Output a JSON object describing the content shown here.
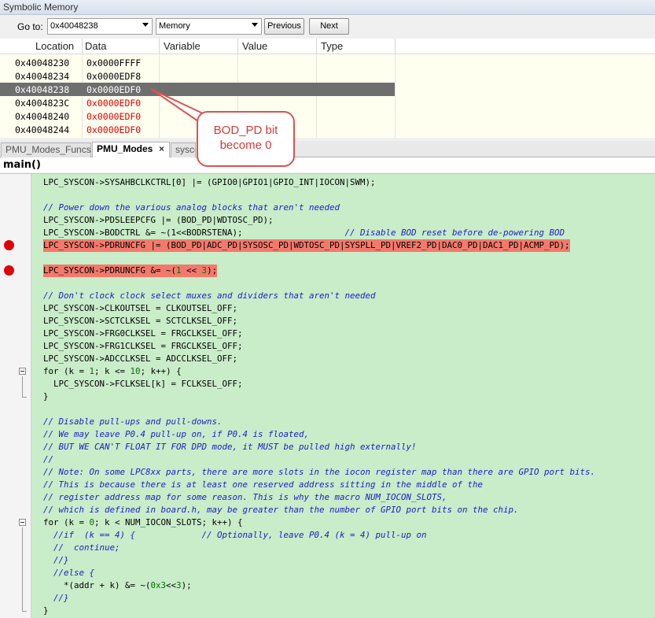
{
  "panel_title": "Symbolic Memory",
  "toolbar": {
    "goto_label": "Go to:",
    "goto_value": "0x40048238",
    "type_value": "Memory",
    "previous_label": "Previous",
    "next_label": "Next"
  },
  "grid": {
    "headers": [
      "Location",
      "Data",
      "Variable",
      "Value",
      "Type"
    ],
    "rows": [
      {
        "addr": "0x40048230",
        "data": "0x0000FFFF"
      },
      {
        "addr": "0x40048234",
        "data": "0x0000EDF8"
      },
      {
        "addr": "0x40048238",
        "data": "0x0000EDF0"
      },
      {
        "addr": "0x4004823C",
        "data": "0x0000EDF0"
      },
      {
        "addr": "0x40048240",
        "data": "0x0000EDF0"
      },
      {
        "addr": "0x40048244",
        "data": "0x0000EDF0"
      }
    ]
  },
  "callout": {
    "line1": "BOD_PD bit",
    "line2": "become 0"
  },
  "tabs": [
    "PMU_Modes_Funcs",
    "PMU_Modes",
    "sysco"
  ],
  "tab_close": "×",
  "function_name": "main()",
  "code": {
    "l1": "LPC_SYSCON->SYSAHBCLKCTRL[0] |= (GPIO0|GPIO1|GPIO_INT|IOCON|SWM);",
    "l2": "// Power down the various analog blocks that aren't needed",
    "l3": "LPC_SYSCON->PDSLEEPCFG |= (BOD_PD|WDTOSC_PD);",
    "l4a": "LPC_SYSCON->BODCTRL &= ~(1<<BODRSTENA);                    ",
    "l4b": "// Disable BOD reset before de-powering BOD",
    "l5": "LPC_SYSCON->PDRUNCFG |= (BOD_PD|ADC_PD|SYSOSC_PD|WDTOSC_PD|SYSPLL_PD|VREF2_PD|DAC0_PD|DAC1_PD|ACMP_PD);",
    "l6a": "LPC_SYSCON->PDRUNCFG &= ~(",
    "l6b": "1",
    "l6c": " << ",
    "l6d": "3",
    "l6e": ");",
    "l7": "// Don't clock clock select muxes and dividers that aren't needed",
    "l8": "LPC_SYSCON->CLKOUTSEL = CLKOUTSEL_OFF;",
    "l9": "LPC_SYSCON->SCTCLKSEL = SCTCLKSEL_OFF;",
    "l10": "LPC_SYSCON->FRG0CLKSEL = FRGCLKSEL_OFF;",
    "l11": "LPC_SYSCON->FRG1CLKSEL = FRGCLKSEL_OFF;",
    "l12": "LPC_SYSCON->ADCCLKSEL = ADCCLKSEL_OFF;",
    "l13a": "for (k = ",
    "l13b": "1",
    "l13c": "; k <= ",
    "l13d": "10",
    "l13e": "; k++) {",
    "l14": "  LPC_SYSCON->FCLKSEL[k] = FCLKSEL_OFF;",
    "l15": "}",
    "l16": "// Disable pull-ups and pull-downs.",
    "l17": "// We may leave P0.4 pull-up on, if P0.4 is floated,",
    "l18": "// BUT WE CAN'T FLOAT IT FOR DPD mode, it MUST be pulled high externally!",
    "l19": "//",
    "l20": "// Note: On some LPC8xx parts, there are more slots in the iocon register map than there are GPIO port bits.",
    "l21": "// This is because there is at least one reserved address sitting in the middle of the",
    "l22": "// register address map for some reason. This is why the macro NUM_IOCON_SLOTS,",
    "l23": "// which is defined in board.h, may be greater than the number of GPIO port bits on the chip.",
    "l24a": "for (k = ",
    "l24b": "0",
    "l24c": "; k < NUM_IOCON_SLOTS; k++) {",
    "l25": "  //if  (k == 4) {             // Optionally, leave P0.4 (k = 4) pull-up on",
    "l26": "  //  continue;",
    "l27": "  //}",
    "l28": "  //else {",
    "l29a": "    *(addr + k) &= ~(",
    "l29b": "0x3",
    "l29c": "<<",
    "l29d": "3",
    "l29e": ");",
    "l30": "  //}",
    "l31": "}"
  }
}
